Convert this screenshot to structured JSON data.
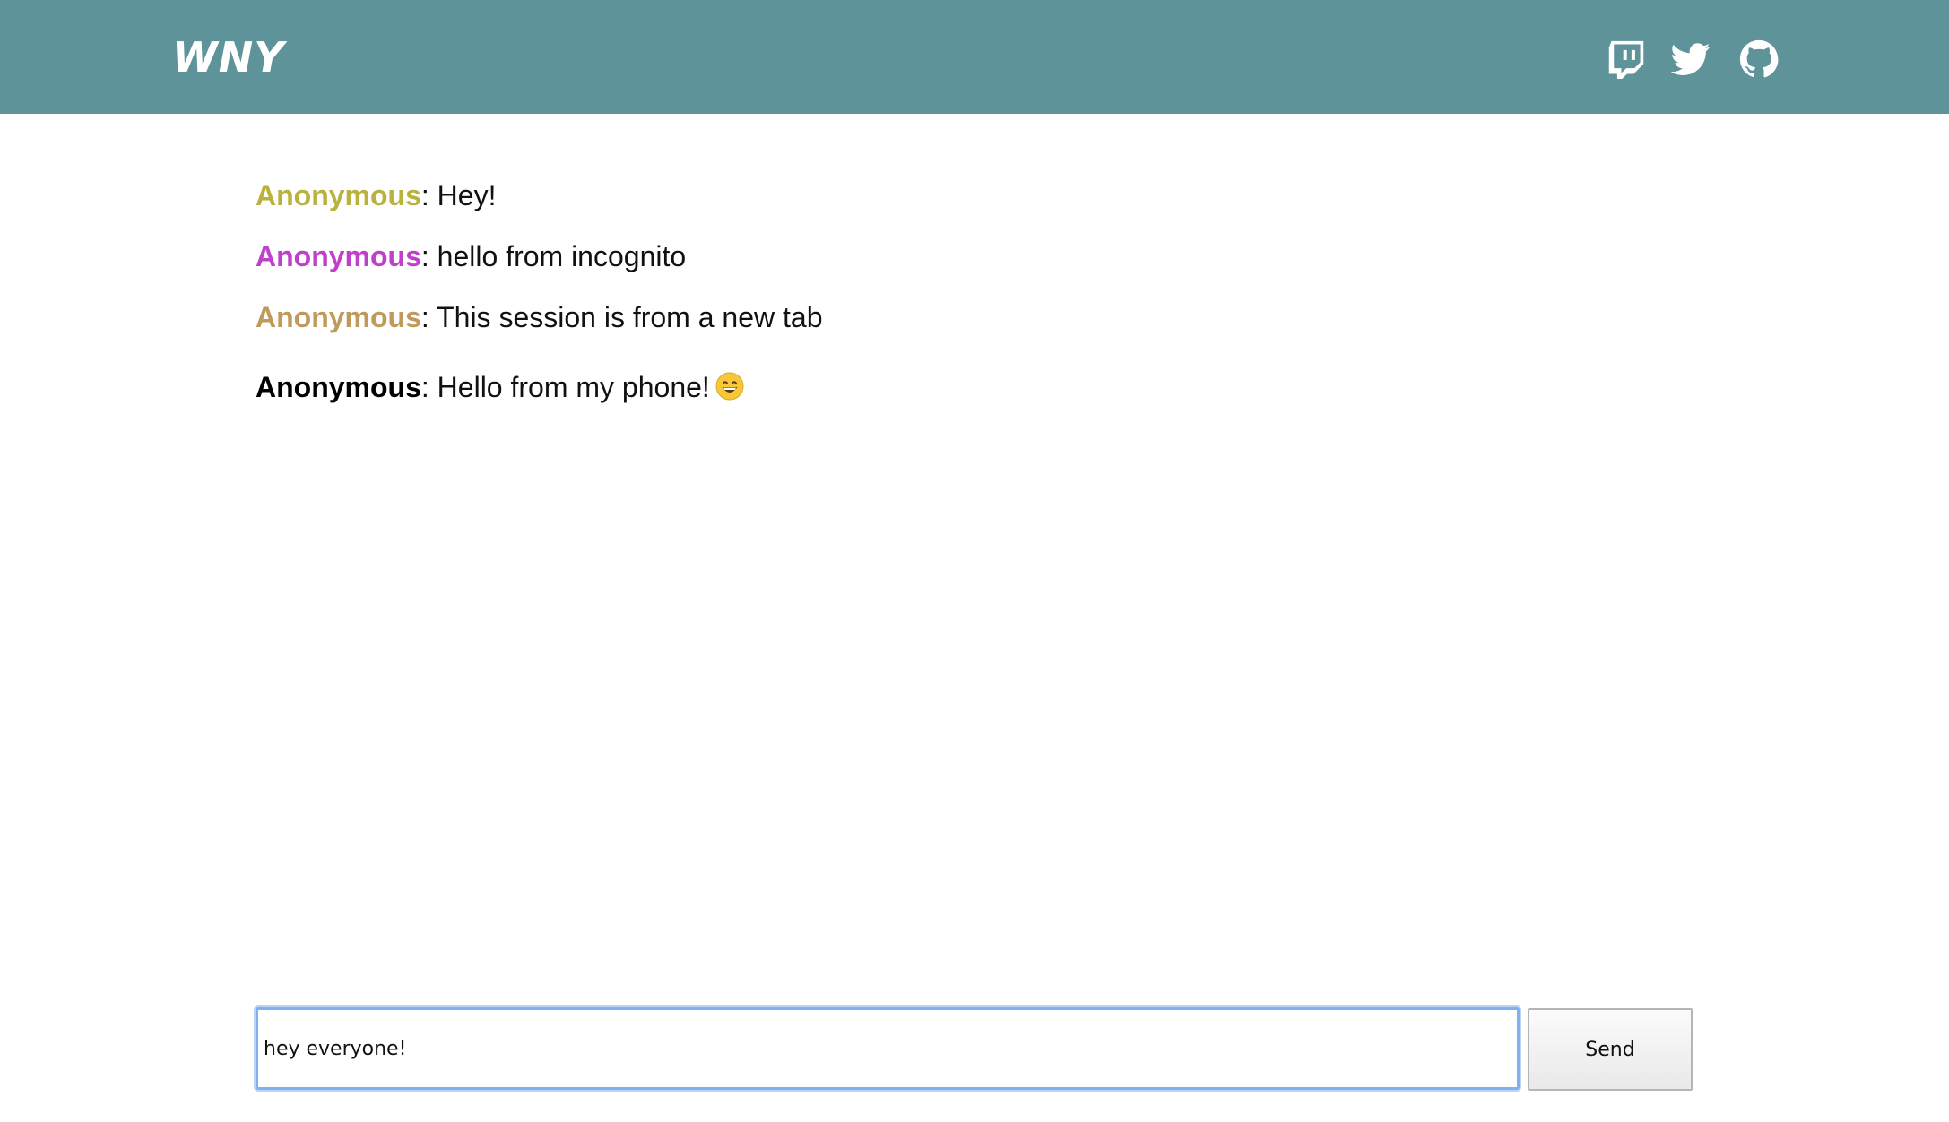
{
  "header": {
    "logo": "WNY",
    "background_color": "#5d9399",
    "links": [
      {
        "icon": "twitch-icon"
      },
      {
        "icon": "twitter-icon"
      },
      {
        "icon": "github-icon"
      }
    ]
  },
  "messages": [
    {
      "user": "Anonymous",
      "separator": ":",
      "text": " Hey!",
      "user_color": "#b9b23c"
    },
    {
      "user": "Anonymous",
      "separator": ":",
      "text": " hello from incognito",
      "user_color": "#c03fcb"
    },
    {
      "user": "Anonymous",
      "separator": ":",
      "text": " This session is from a new tab",
      "user_color": "#bf9a5a"
    },
    {
      "user": "Anonymous",
      "separator": ":",
      "text": " Hello from my phone!",
      "user_color": "#000000",
      "emoji": "grinning-face-icon"
    }
  ],
  "composer": {
    "input_value": "hey everyone!",
    "send_label": "Send"
  }
}
